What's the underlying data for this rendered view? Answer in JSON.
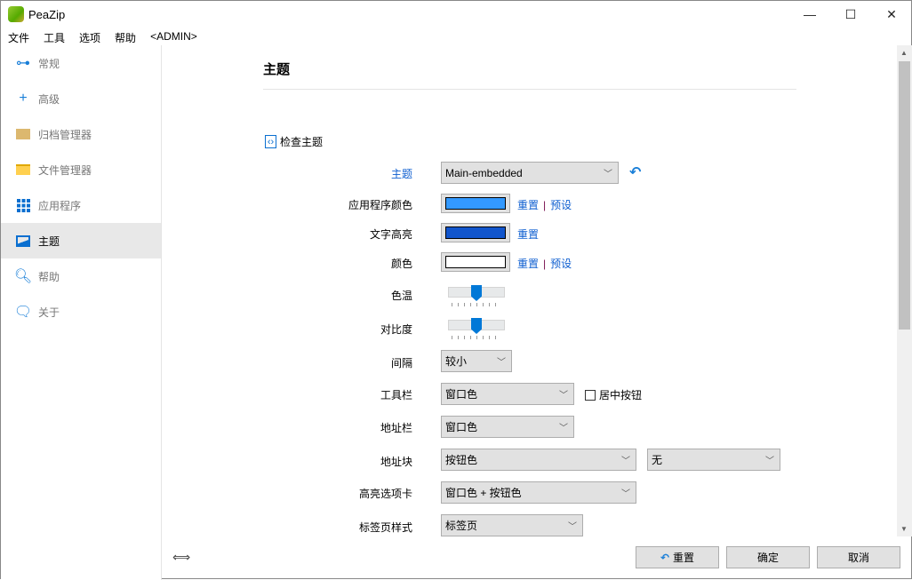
{
  "window": {
    "title": "PeaZip",
    "minimize": "—",
    "maximize": "☐",
    "close": "✕"
  },
  "menu": [
    "文件",
    "工具",
    "选项",
    "帮助",
    "<ADMIN>"
  ],
  "sidebar": {
    "items": [
      {
        "label": "常规",
        "icon": "sliders-icon"
      },
      {
        "label": "高级",
        "icon": "plus-icon"
      },
      {
        "label": "归档管理器",
        "icon": "archive-icon"
      },
      {
        "label": "文件管理器",
        "icon": "folder-icon"
      },
      {
        "label": "应用程序",
        "icon": "grid-icon"
      },
      {
        "label": "主题",
        "icon": "image-icon",
        "active": true
      },
      {
        "label": "帮助",
        "icon": "search-icon"
      },
      {
        "label": "关于",
        "icon": "chat-icon"
      }
    ]
  },
  "main": {
    "heading": "主题",
    "check_theme": "检查主题",
    "theme_label": "主题",
    "theme_value": "Main-embedded",
    "app_color_label": "应用程序颜色",
    "app_color": "#3399ff",
    "text_highlight_label": "文字高亮",
    "text_highlight_color": "#1155cc",
    "color_label": "颜色",
    "color_value": "#ffffff",
    "reset": "重置",
    "preset": "预设",
    "color_temp_label": "色温",
    "color_temp_value": 0.5,
    "contrast_label": "对比度",
    "contrast_value": 0.5,
    "spacing_label": "间隔",
    "spacing_value": "较小",
    "toolbar_label": "工具栏",
    "toolbar_value": "窗口色",
    "center_buttons": "居中按钮",
    "address_bar_label": "地址栏",
    "address_bar_value": "窗口色",
    "address_block_label": "地址块",
    "address_block_value": "按钮色",
    "address_block_value2": "无",
    "highlight_tab_label": "高亮选项卡",
    "highlight_tab_value": "窗口色 + 按钮色",
    "tab_style_label": "标签页样式",
    "tab_style_value": "标签页"
  },
  "footer": {
    "reset": "重置",
    "ok": "确定",
    "cancel": "取消"
  }
}
